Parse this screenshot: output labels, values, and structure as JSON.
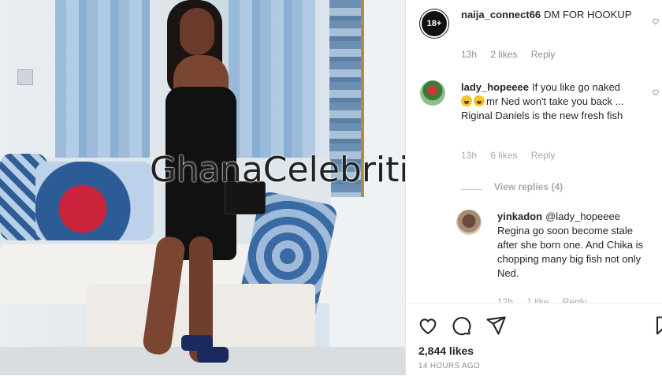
{
  "watermark": "GhanaCelebrities.Com",
  "comments": [
    {
      "avatar_badge": "18+",
      "username": "naija_connect66",
      "text": "DM FOR HOOKUP",
      "time": "13h",
      "likes": "2 likes",
      "reply": "Reply"
    },
    {
      "username": "lady_hopeeee",
      "text_part1": "If you like go naked",
      "text_part2": "mr Ned won't take you back ... Riginal Daniels is the new fresh fish",
      "time": "13h",
      "likes": "6 likes",
      "reply": "Reply",
      "view_replies": "View replies (4)"
    },
    {
      "username": "yinkadon",
      "text": "@lady_hopeeee Regina go soon become stale after she born one. And Chika is chopping many big fish not only Ned.",
      "time": "12h",
      "likes": "1 like",
      "reply": "Reply"
    }
  ],
  "actions": {
    "icons": [
      "heart-icon",
      "comment-icon",
      "share-icon",
      "bookmark-icon"
    ],
    "likes_count": "2,844 likes",
    "timestamp": "14 HOURS AGO"
  }
}
